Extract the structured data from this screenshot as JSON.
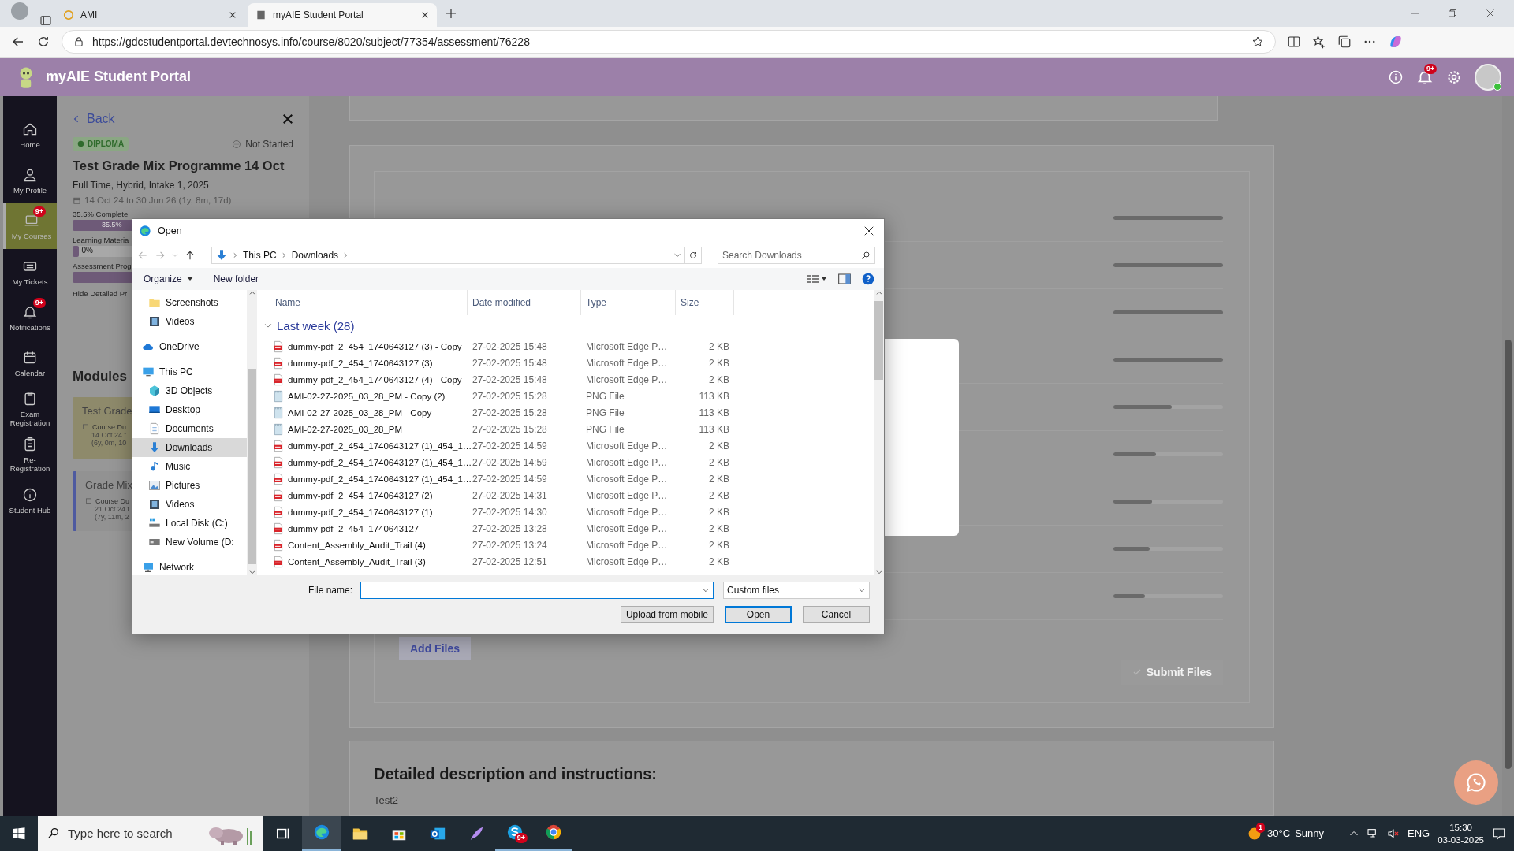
{
  "browser": {
    "tabs": [
      {
        "title": "AMI",
        "selected": false
      },
      {
        "title": "myAIE Student Portal",
        "selected": true
      }
    ],
    "url": "https://gdcstudentportal.devtechnosys.info/course/8020/subject/77354/assessment/76228"
  },
  "header": {
    "title": "myAIE Student Portal",
    "notification_badge": "9+"
  },
  "sidebar": {
    "items": [
      {
        "kind": "home",
        "label": "Home",
        "selected": false
      },
      {
        "kind": "profile",
        "label": "My Profile",
        "selected": false
      },
      {
        "kind": "courses",
        "label": "My Courses",
        "selected": true,
        "badge": "9+"
      },
      {
        "kind": "tickets",
        "label": "My Tickets",
        "selected": false
      },
      {
        "kind": "notifications",
        "label": "Notifications",
        "selected": false,
        "badge": "9+"
      },
      {
        "kind": "calendar",
        "label": "Calendar",
        "selected": false
      },
      {
        "kind": "exam",
        "label": "Exam Registration",
        "selected": false
      },
      {
        "kind": "reregistration",
        "label": "Re-Registration",
        "selected": false
      },
      {
        "kind": "hub",
        "label": "Student Hub",
        "selected": false
      }
    ]
  },
  "course_panel": {
    "back": "Back",
    "level_badge": "DIPLOMA",
    "status": "Not Started",
    "title": "Test Grade Mix Programme 14 Oct",
    "subtitle": "Full Time, Hybrid, Intake 1, 2025",
    "dates": "14 Oct 24 to 30 Jun 26 (1y, 8m, 17d)",
    "progress": [
      {
        "label": "35.5% Complete",
        "level": 0.355,
        "reading": "35.5%"
      },
      {
        "label": "Learning Materia",
        "level": 0.03,
        "reading": "0%"
      },
      {
        "label": "Assessment Prog",
        "level": 1
      }
    ],
    "toggle": "Hide Detailed Pr",
    "modules_heading": "Modules",
    "modules": [
      {
        "title": "Test Grade",
        "duration_label": "Course Du",
        "dates": "14 Oct 24 t",
        "length": "(6y, 0m, 10",
        "selected": true
      },
      {
        "title": "Grade Mix",
        "duration_label": "Course Du",
        "dates": "21 Oct 24 t",
        "length": "(7y, 11m, 2",
        "selected": false
      }
    ]
  },
  "submission": {
    "uploads": [
      {
        "level": 1
      },
      {
        "level": 1
      },
      {
        "level": 1
      },
      {
        "level": 1
      },
      {
        "level": 0.53
      },
      {
        "level": 0.39
      },
      {
        "level": 0.35
      },
      {
        "level": 0.33
      },
      {
        "level": 0.29
      }
    ],
    "add_files": "Add Files",
    "submit": "Submit Files"
  },
  "description": {
    "heading": "Detailed description and instructions:",
    "text": "Test2"
  },
  "dialog": {
    "title": "Open",
    "path": [
      "This PC",
      "Downloads"
    ],
    "search_placeholder": "Search Downloads",
    "toolbar": [
      "Organize",
      "New folder"
    ],
    "nav_pane": {
      "continued_items": [
        {
          "kind": "folder",
          "label": "Screenshots",
          "selected": false
        },
        {
          "kind": "video",
          "label": "Videos",
          "selected": false
        }
      ],
      "items": [
        {
          "kind": "cloud",
          "label": "OneDrive",
          "selected": false
        },
        {
          "kind": "pc",
          "label": "This PC",
          "selected": false,
          "children": [
            {
              "kind": "cube",
              "label": "3D Objects",
              "selected": false
            },
            {
              "kind": "desktop",
              "label": "Desktop",
              "selected": false
            },
            {
              "kind": "documents",
              "label": "Documents",
              "selected": false
            },
            {
              "kind": "download",
              "label": "Downloads",
              "selected": true
            },
            {
              "kind": "music",
              "label": "Music",
              "selected": false
            },
            {
              "kind": "pictures",
              "label": "Pictures",
              "selected": false
            },
            {
              "kind": "video",
              "label": "Videos",
              "selected": false
            },
            {
              "kind": "disk",
              "label": "Local Disk (C:)",
              "selected": false
            },
            {
              "kind": "drive",
              "label": "New Volume (D:",
              "selected": false
            }
          ]
        },
        {
          "kind": "network",
          "label": "Network",
          "selected": false
        }
      ]
    },
    "columns": [
      "Name",
      "Date modified",
      "Type",
      "Size"
    ],
    "group": "Last week (28)",
    "files": [
      {
        "kind": "pdf",
        "name": "dummy-pdf_2_454_1740643127 (3) - Copy",
        "date": "27-02-2025 15:48",
        "type": "Microsoft Edge P…",
        "size": "2 KB"
      },
      {
        "kind": "pdf",
        "name": "dummy-pdf_2_454_1740643127 (3)",
        "date": "27-02-2025 15:48",
        "type": "Microsoft Edge P…",
        "size": "2 KB"
      },
      {
        "kind": "pdf",
        "name": "dummy-pdf_2_454_1740643127 (4) - Copy",
        "date": "27-02-2025 15:48",
        "type": "Microsoft Edge P…",
        "size": "2 KB"
      },
      {
        "kind": "png",
        "name": "AMI-02-27-2025_03_28_PM - Copy (2)",
        "date": "27-02-2025 15:28",
        "type": "PNG File",
        "size": "113 KB"
      },
      {
        "kind": "png",
        "name": "AMI-02-27-2025_03_28_PM - Copy",
        "date": "27-02-2025 15:28",
        "type": "PNG File",
        "size": "113 KB"
      },
      {
        "kind": "png",
        "name": "AMI-02-27-2025_03_28_PM",
        "date": "27-02-2025 15:28",
        "type": "PNG File",
        "size": "113 KB"
      },
      {
        "kind": "pdf",
        "name": "dummy-pdf_2_454_1740643127 (1)_454_1…",
        "date": "27-02-2025 14:59",
        "type": "Microsoft Edge P…",
        "size": "2 KB"
      },
      {
        "kind": "pdf",
        "name": "dummy-pdf_2_454_1740643127 (1)_454_1…",
        "date": "27-02-2025 14:59",
        "type": "Microsoft Edge P…",
        "size": "2 KB"
      },
      {
        "kind": "pdf",
        "name": "dummy-pdf_2_454_1740643127 (1)_454_1…",
        "date": "27-02-2025 14:59",
        "type": "Microsoft Edge P…",
        "size": "2 KB"
      },
      {
        "kind": "pdf",
        "name": "dummy-pdf_2_454_1740643127 (2)",
        "date": "27-02-2025 14:31",
        "type": "Microsoft Edge P…",
        "size": "2 KB"
      },
      {
        "kind": "pdf",
        "name": "dummy-pdf_2_454_1740643127 (1)",
        "date": "27-02-2025 14:30",
        "type": "Microsoft Edge P…",
        "size": "2 KB"
      },
      {
        "kind": "pdf",
        "name": "dummy-pdf_2_454_1740643127",
        "date": "27-02-2025 13:28",
        "type": "Microsoft Edge P…",
        "size": "2 KB"
      },
      {
        "kind": "pdf",
        "name": "Content_Assembly_Audit_Trail (4)",
        "date": "27-02-2025 13:24",
        "type": "Microsoft Edge P…",
        "size": "2 KB"
      },
      {
        "kind": "pdf",
        "name": "Content_Assembly_Audit_Trail (3)",
        "date": "27-02-2025 12:51",
        "type": "Microsoft Edge P…",
        "size": "2 KB"
      }
    ],
    "file_name_label": "File name:",
    "filter": "Custom files",
    "buttons": [
      {
        "label": "Upload from mobile",
        "default": false
      },
      {
        "label": "Open",
        "default": true
      },
      {
        "label": "Cancel",
        "default": false
      }
    ]
  },
  "taskbar": {
    "search_placeholder": "Type here to search",
    "apps": [
      {
        "kind": "taskview",
        "running": false
      },
      {
        "kind": "edge",
        "running": true,
        "active": true
      },
      {
        "kind": "explorer",
        "running": false
      },
      {
        "kind": "store",
        "running": false
      },
      {
        "kind": "outlook",
        "running": false
      },
      {
        "kind": "feather",
        "running": false
      },
      {
        "kind": "skype",
        "running": true,
        "badge": "9+"
      },
      {
        "kind": "chrome",
        "running": true
      }
    ],
    "weather": {
      "badge": "1",
      "temperature": "30°C",
      "condition": "Sunny"
    },
    "language": "ENG",
    "time": "15:30",
    "date": "03-03-2025"
  }
}
